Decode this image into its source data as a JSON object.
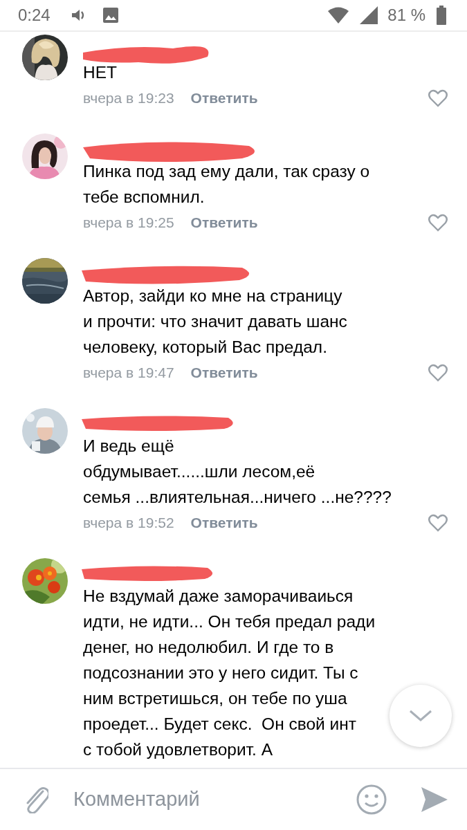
{
  "status_bar": {
    "time": "0:24",
    "battery": "81 %"
  },
  "comments": [
    {
      "lines": [
        "НЕТ"
      ],
      "date": "вчера в 19:23",
      "reply": "Ответить",
      "liked": false
    },
    {
      "lines": [
        "Пинка под зад ему дали, так сразу о",
        "тебе вспомнил."
      ],
      "date": "вчера в 19:25",
      "reply": "Ответить",
      "liked": false
    },
    {
      "lines": [
        "Автор, зайди ко мне на страницу",
        "и прочти: что значит давать шанс",
        "человеку, который Вас предал."
      ],
      "date": "вчера в 19:47",
      "reply": "Ответить",
      "liked": false
    },
    {
      "lines": [
        "И ведь ещё",
        "обдумывает......шли лесом,её",
        "семья ...влиятельная...ничего ...не????"
      ],
      "date": "вчера в 19:52",
      "reply": "Ответить",
      "liked": false
    },
    {
      "lines": [
        "Не вздумай даже заморачиваиься",
        "идти, не идти... Он тебя предал ради",
        "денег, но недолюбил. И где то в",
        "подсознании это у него сидит. Ты с",
        "ним встретишься, он тебе по уша",
        "проедет... Будет секс.  Он свой инт",
        "с тобой удовлетворит. А"
      ]
    }
  ],
  "composer": {
    "placeholder": "Комментарий"
  }
}
